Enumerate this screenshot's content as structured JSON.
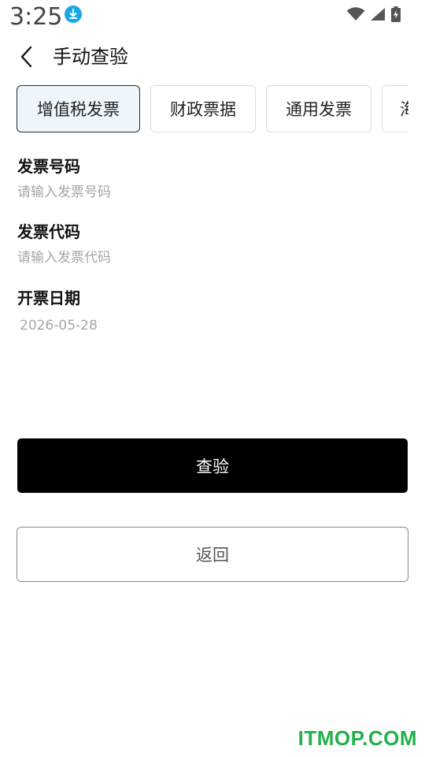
{
  "status_bar": {
    "time": "3:25",
    "icons": [
      "download-icon",
      "wifi-icon",
      "signal-icon",
      "battery-charging-icon"
    ]
  },
  "header": {
    "back_icon": "chevron-left-icon",
    "title": "手动查验"
  },
  "tabs": [
    {
      "label": "增值税发票",
      "active": true
    },
    {
      "label": "财政票据",
      "active": false
    },
    {
      "label": "通用发票",
      "active": false
    },
    {
      "label": "海",
      "active": false
    }
  ],
  "form": {
    "invoice_number": {
      "label": "发票号码",
      "placeholder": "请输入发票号码",
      "value": ""
    },
    "invoice_code": {
      "label": "发票代码",
      "placeholder": "请输入发票代码",
      "value": ""
    },
    "issue_date": {
      "label": "开票日期",
      "value": "2026-05-28"
    }
  },
  "buttons": {
    "verify_label": "查验",
    "back_label": "返回"
  },
  "watermark": {
    "text": "ITMOP.COM",
    "color": "#22b14c"
  },
  "colors": {
    "primary": "#000000",
    "active_tab_bg": "#eef5fb",
    "placeholder": "#a6a6a6",
    "download_badge": "#19a7e8"
  }
}
